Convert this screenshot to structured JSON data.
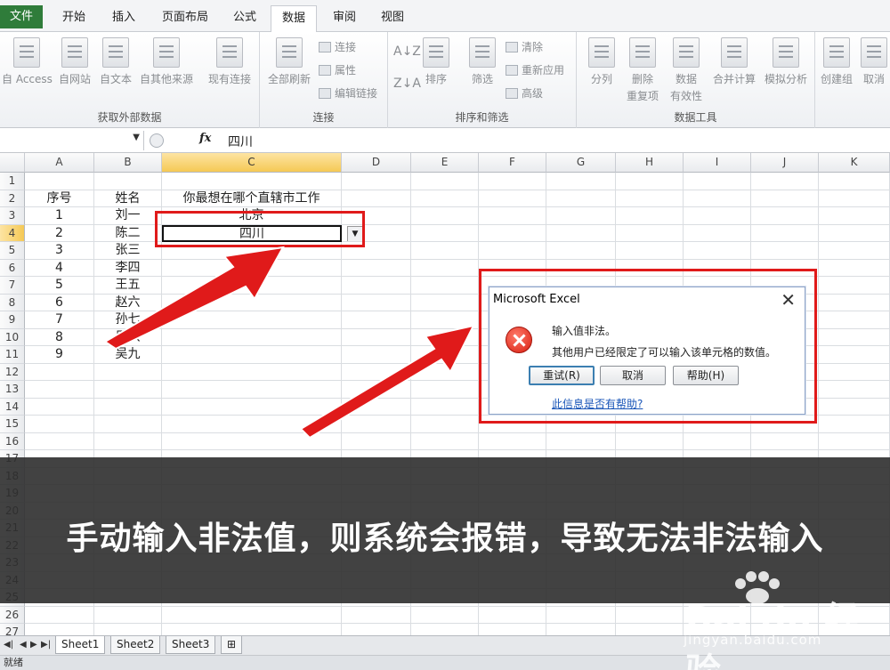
{
  "ribbon_tabs": [
    "文件",
    "开始",
    "插入",
    "页面布局",
    "公式",
    "数据",
    "审阅",
    "视图"
  ],
  "ribbon": {
    "get_external": {
      "label": "获取外部数据",
      "buttons": [
        "自 Access",
        "自网站",
        "自文本",
        "自其他来源",
        "现有连接"
      ]
    },
    "connections": {
      "label": "连接",
      "refresh_all": "全部刷新",
      "small": [
        "连接",
        "属性",
        "编辑链接"
      ]
    },
    "sort_filter": {
      "label": "排序和筛选",
      "sort": "排序",
      "filter": "筛选",
      "small": [
        "清除",
        "重新应用",
        "高级"
      ]
    },
    "data_tools": {
      "label": "数据工具",
      "split": "分列",
      "remove_dup": [
        "删除",
        "重复项"
      ],
      "validation": [
        "数据",
        "有效性"
      ],
      "consolidate": "合并计算",
      "whatif": "模拟分析"
    },
    "outline": {
      "group": "创建组",
      "ungroup": "取消"
    }
  },
  "formula_bar": {
    "fx": "fx",
    "value": "四川"
  },
  "columns": [
    "A",
    "B",
    "C",
    "D",
    "E",
    "F",
    "G",
    "H",
    "I",
    "J",
    "K"
  ],
  "rows": [
    "1",
    "2",
    "3",
    "4",
    "5",
    "6",
    "7",
    "8",
    "9",
    "10",
    "11",
    "12",
    "13",
    "14",
    "15",
    "16",
    "17",
    "18",
    "19",
    "20",
    "21",
    "22",
    "23",
    "24",
    "25",
    "26",
    "27"
  ],
  "cells": {
    "A2": "序号",
    "B2": "姓名",
    "C2": "你最想在哪个直辖市工作",
    "A3": "1",
    "B3": "刘一",
    "C3": "北京",
    "A4": "2",
    "B4": "陈二",
    "C4": "四川",
    "A5": "3",
    "B5": "张三",
    "A6": "4",
    "B6": "李四",
    "A7": "5",
    "B7": "王五",
    "A8": "6",
    "B8": "赵六",
    "A9": "7",
    "B9": "孙七",
    "A10": "8",
    "B10": "周八",
    "A11": "9",
    "B11": "吴九"
  },
  "sheets": [
    "Sheet1",
    "Sheet2",
    "Sheet3"
  ],
  "status": "就绪",
  "dialog": {
    "title": "Microsoft Excel",
    "message1": "输入值非法。",
    "message2": "其他用户已经限定了可以输入该单元格的数值。",
    "retry": "重试(R)",
    "cancel": "取消",
    "help": "帮助(H)",
    "link": "此信息是否有帮助?"
  },
  "banner": "手动输入非法值，则系统会报错，导致无法非法输入",
  "watermark": {
    "brand": "Bai du 经验",
    "url": "jingyan.baidu.com"
  },
  "colors": {
    "file_tab": "#2f7c3a",
    "annotation_red": "#e01a1a",
    "selected_header": "#f5c955"
  }
}
